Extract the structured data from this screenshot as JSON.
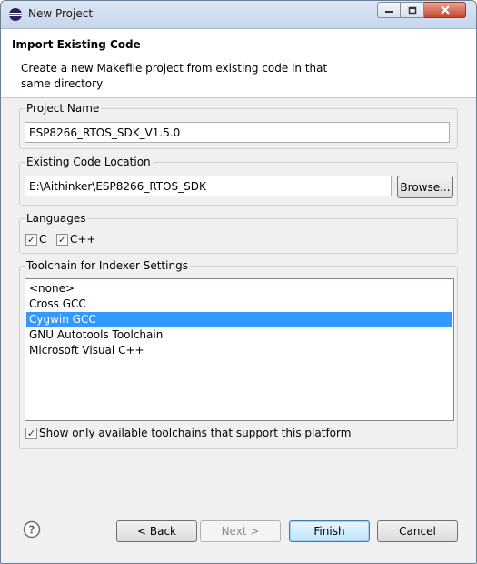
{
  "window": {
    "title": "New Project",
    "icon": "eclipse-logo-icon"
  },
  "header": {
    "title": "Import Existing Code",
    "description": "Create a new Makefile project from existing code in that same directory"
  },
  "project_name": {
    "label": "Project Name",
    "value": "ESP8266_RTOS_SDK_V1.5.0"
  },
  "code_location": {
    "label": "Existing Code Location",
    "value": "E:\\Aithinker\\ESP8266_RTOS_SDK",
    "browse_label": "Browse..."
  },
  "languages": {
    "label": "Languages",
    "items": [
      {
        "label": "C",
        "checked": true
      },
      {
        "label": "C++",
        "checked": true
      }
    ]
  },
  "toolchain": {
    "label": "Toolchain for Indexer Settings",
    "items": [
      "<none>",
      "Cross GCC",
      "Cygwin GCC",
      "GNU Autotools Toolchain",
      "Microsoft Visual C++"
    ],
    "selected": "Cygwin GCC",
    "filter_label": "Show only available toolchains that support this platform",
    "filter_checked": true
  },
  "footer": {
    "back_label": "< Back",
    "next_label": "Next >",
    "finish_label": "Finish",
    "cancel_label": "Cancel"
  },
  "colors": {
    "selection": "#3399ff",
    "dialog_bg": "#f0f0f0"
  }
}
